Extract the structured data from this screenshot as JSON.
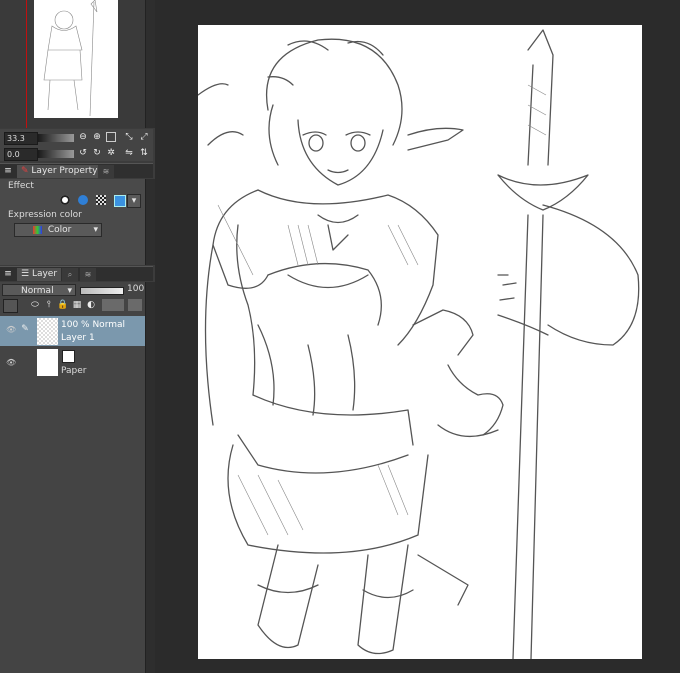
{
  "navigator": {},
  "tool_props": {
    "size_value": "33.3",
    "opacity_value": "0.0"
  },
  "layer_property": {
    "tab_label": "Layer Property",
    "effect_label": "Effect",
    "expression_color_label": "Expression color",
    "expression_color_value": "Color"
  },
  "layer_panel": {
    "tab_label": "Layer",
    "blend_mode": "Normal",
    "opacity": "100",
    "layers": [
      {
        "mode": "100 % Normal",
        "name": "Layer 1",
        "selected": true
      },
      {
        "mode": "",
        "name": "Paper",
        "selected": false
      }
    ]
  },
  "colors": {
    "selected_layer": "#7b98ad",
    "panel": "#444444",
    "workspace": "#2b2b2b",
    "canvas": "#ffffff"
  }
}
